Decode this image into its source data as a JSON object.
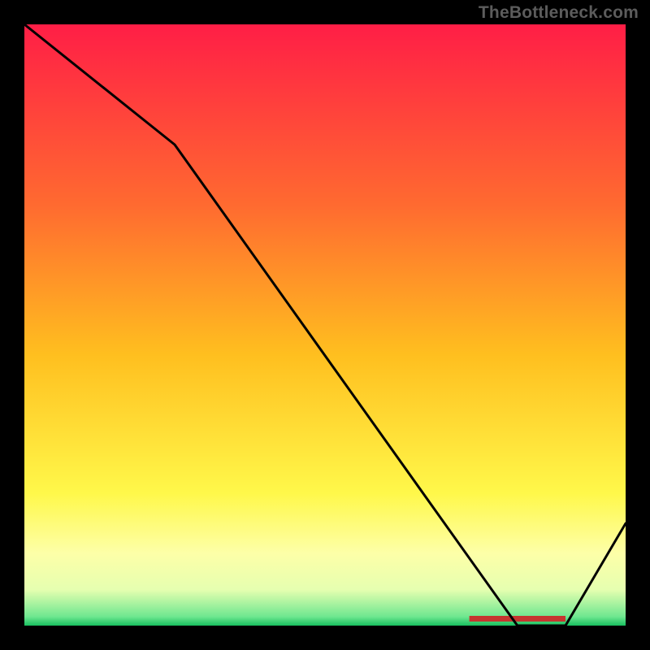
{
  "watermark": "TheBottleneck.com",
  "chart_data": {
    "type": "line",
    "title": "",
    "xlabel": "",
    "ylabel": "",
    "xlim": [
      0,
      100
    ],
    "ylim": [
      0,
      100
    ],
    "x": [
      0,
      25,
      82,
      90,
      100
    ],
    "values": [
      100,
      80,
      0,
      0,
      17
    ],
    "optimal_band": {
      "x_start": 74,
      "x_end": 90
    },
    "background_gradient": {
      "stops": [
        {
          "offset": 0,
          "color": "#ff1e46"
        },
        {
          "offset": 0.3,
          "color": "#ff6a30"
        },
        {
          "offset": 0.55,
          "color": "#ffbf1f"
        },
        {
          "offset": 0.78,
          "color": "#fff84a"
        },
        {
          "offset": 0.88,
          "color": "#fdffa8"
        },
        {
          "offset": 0.94,
          "color": "#e6ffb0"
        },
        {
          "offset": 0.985,
          "color": "#6fe790"
        },
        {
          "offset": 1.0,
          "color": "#18c060"
        }
      ]
    },
    "colors": {
      "line": "#000000",
      "band": "#c6352f"
    }
  }
}
